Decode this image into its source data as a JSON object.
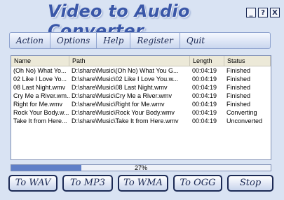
{
  "app": {
    "title": "Video to Audio Converter"
  },
  "window_buttons": {
    "minimize": "_",
    "help": "?",
    "close": "X"
  },
  "menu": [
    "Action",
    "Options",
    "Help",
    "Register",
    "Quit"
  ],
  "table": {
    "columns": [
      "Name",
      "Path",
      "Length",
      "Status"
    ],
    "rows": [
      [
        "(Oh No) What Yo...",
        "D:\\share\\Music\\(Oh No) What You G...",
        "00:04:19",
        "Finished"
      ],
      [
        "02 Like I Love Yo...",
        "D:\\share\\Music\\02 Like I Love You.w...",
        "00:04:19",
        "Finished"
      ],
      [
        "08 Last Night.wmv",
        "D:\\share\\Music\\08 Last Night.wmv",
        "00:04:19",
        "Finished"
      ],
      [
        "Cry Me a River.wm...",
        "D:\\share\\Music\\Cry Me a River.wmv",
        "00:04:19",
        "Finished"
      ],
      [
        "Right for Me.wmv",
        "D:\\share\\Music\\Right for Me.wmv",
        "00:04:19",
        "Finished"
      ],
      [
        "Rock Your Body.w...",
        "D:\\share\\Music\\Rock Your Body.wmv",
        "00:04:19",
        "Converting"
      ],
      [
        "Take It from Here...",
        "D:\\share\\Music\\Take It from Here.wmv",
        "00:04:19",
        "Unconverted"
      ]
    ]
  },
  "progress": {
    "label": "27%",
    "fraction": 0.27
  },
  "buttons": {
    "to_wav": "To WAV",
    "to_mp3": "To MP3",
    "to_wma": "To WMA",
    "to_ogg": "To OGG",
    "stop": "Stop"
  },
  "colors": {
    "accent": "#3a57a8",
    "background": "#d9e3f3",
    "button_border": "#1c2a55"
  }
}
